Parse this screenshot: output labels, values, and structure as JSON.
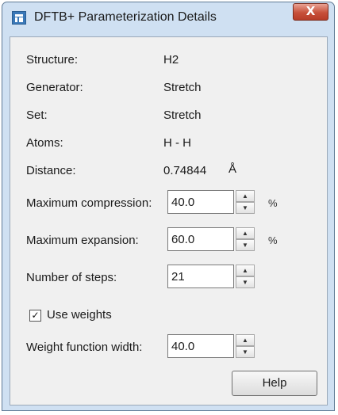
{
  "window": {
    "title": "DFTB+ Parameterization Details",
    "close_glyph": "X"
  },
  "info": [
    {
      "label": "Structure:",
      "value": "H2"
    },
    {
      "label": "Generator:",
      "value": "Stretch"
    },
    {
      "label": "Set:",
      "value": "Stretch"
    },
    {
      "label": "Atoms:",
      "value": "H - H"
    },
    {
      "label": "Distance:",
      "value": "0.74844",
      "unit": "Å"
    }
  ],
  "fields": [
    {
      "label": "Maximum compression:",
      "value": "40.0",
      "unit": "%"
    },
    {
      "label": "Maximum expansion:",
      "value": "60.0",
      "unit": "%"
    },
    {
      "label": "Number of steps:",
      "value": "21"
    }
  ],
  "use_weights": {
    "label": "Use weights",
    "checked": true,
    "mark": "✓"
  },
  "weight_width": {
    "label": "Weight function width:",
    "value": "40.0"
  },
  "spin_glyphs": {
    "up": "▲",
    "down": "▼"
  },
  "help_button": {
    "label": "Help"
  }
}
